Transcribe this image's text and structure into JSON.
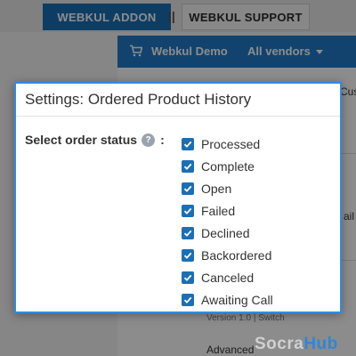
{
  "topbar": {
    "addon_label": "WEBKUL ADDON",
    "separator": "||",
    "support_label": "WEBKUL SUPPORT"
  },
  "navbar": {
    "store_name": "Webkul Demo",
    "vendors_label": "All vendors"
  },
  "background": {
    "frag_cus": "Cus",
    "frag_ail": "ail",
    "frag_version": "Version 1.0 | Switch",
    "frag_advanced": "Advanced"
  },
  "modal": {
    "title": "Settings: Ordered Product History",
    "field_label": "Select order status",
    "help_icon_glyph": "?",
    "colon": ":",
    "statuses": [
      {
        "label": "Processed",
        "checked": true
      },
      {
        "label": "Complete",
        "checked": true
      },
      {
        "label": "Open",
        "checked": true
      },
      {
        "label": "Failed",
        "checked": true
      },
      {
        "label": "Declined",
        "checked": true
      },
      {
        "label": "Backordered",
        "checked": true
      },
      {
        "label": "Canceled",
        "checked": true
      },
      {
        "label": "Awaiting Call",
        "checked": true
      }
    ]
  },
  "watermark": {
    "part_a": "Socra",
    "part_b": "Hub"
  },
  "colors": {
    "accent": "#1a6fb6",
    "modal_border": "#2f8be6",
    "navbar": "#1f7ac9"
  },
  "icons": {
    "cart": "cart-icon",
    "caret": "chevron-down-icon",
    "help": "question-icon",
    "checkbox": "checkmark-icon"
  }
}
